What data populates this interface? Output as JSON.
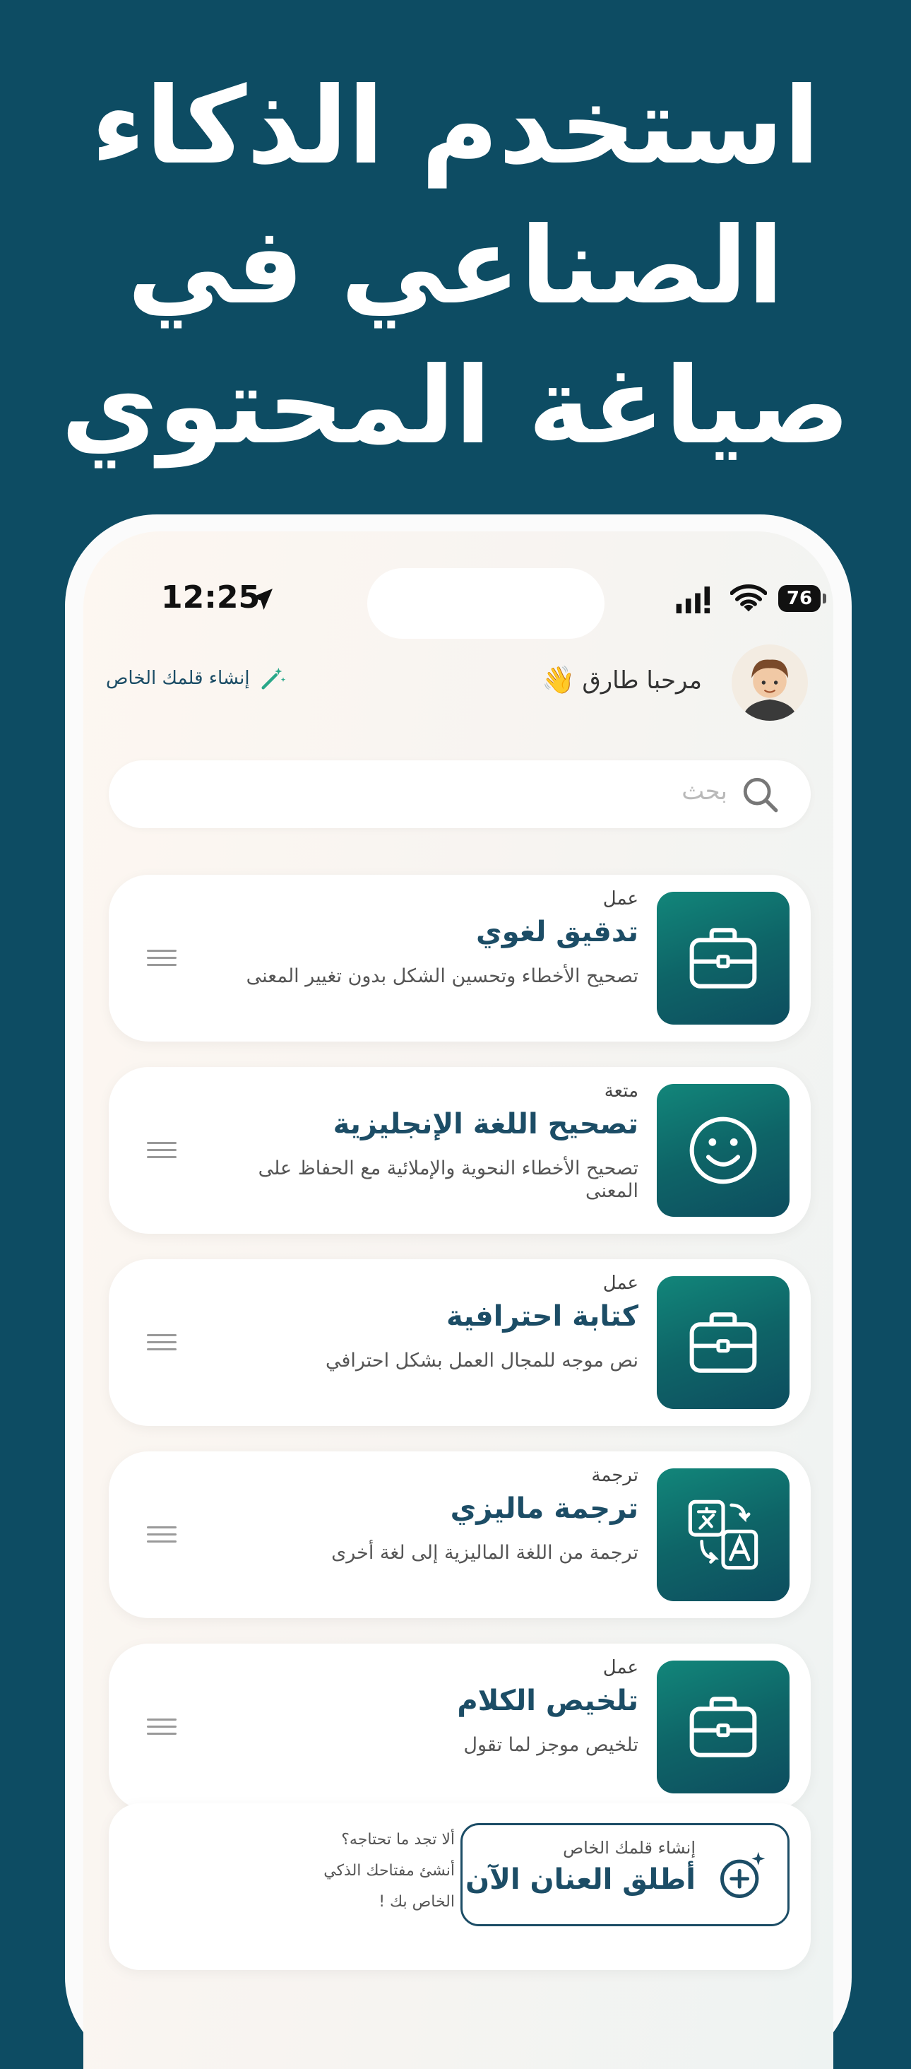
{
  "headline": {
    "line1": "استخدم الذكاء",
    "line2": "الصناعي في",
    "line3": "صياغة المحتوي"
  },
  "status_bar": {
    "time": "12:25",
    "battery": "76"
  },
  "header": {
    "greeting": "مرحبا طارق",
    "greeting_emoji": "👋",
    "create_link": "إنشاء قلمك الخاص"
  },
  "search": {
    "placeholder": "بحث"
  },
  "cards": [
    {
      "category": "عمل",
      "title": "تدقيق لغوي",
      "description": "تصحيح الأخطاء وتحسين الشكل بدون تغيير المعنى",
      "icon": "briefcase-icon"
    },
    {
      "category": "متعة",
      "title": "تصحيح اللغة الإنجليزية",
      "description": "تصحيح الأخطاء النحوية والإملائية مع الحفاظ على المعنى",
      "icon": "smiley-icon"
    },
    {
      "category": "عمل",
      "title": "كتابة احترافية",
      "description": "نص موجه للمجال العمل بشكل احترافي",
      "icon": "briefcase-icon"
    },
    {
      "category": "ترجمة",
      "title": "ترجمة ماليزي",
      "description": "ترجمة من اللغة الماليزية إلى لغة أخرى",
      "icon": "translate-icon"
    },
    {
      "category": "عمل",
      "title": "تلخيص الكلام",
      "description": "تلخيص موجز لما تقول",
      "icon": "briefcase-icon"
    }
  ],
  "banner": {
    "small": "إنشاء قلمك الخاص",
    "big": "أطلق العنان الآن",
    "note_line1": "ألا تجد ما تحتاجه؟",
    "note_line2": "أنشئ مفتاحك الذكي",
    "note_line3": "الخاص بك !"
  },
  "colors": {
    "background": "#0d4c63",
    "accent": "#1c4d66",
    "tile_gradient_top": "#12867a",
    "tile_gradient_bottom": "#0d4d5f"
  }
}
